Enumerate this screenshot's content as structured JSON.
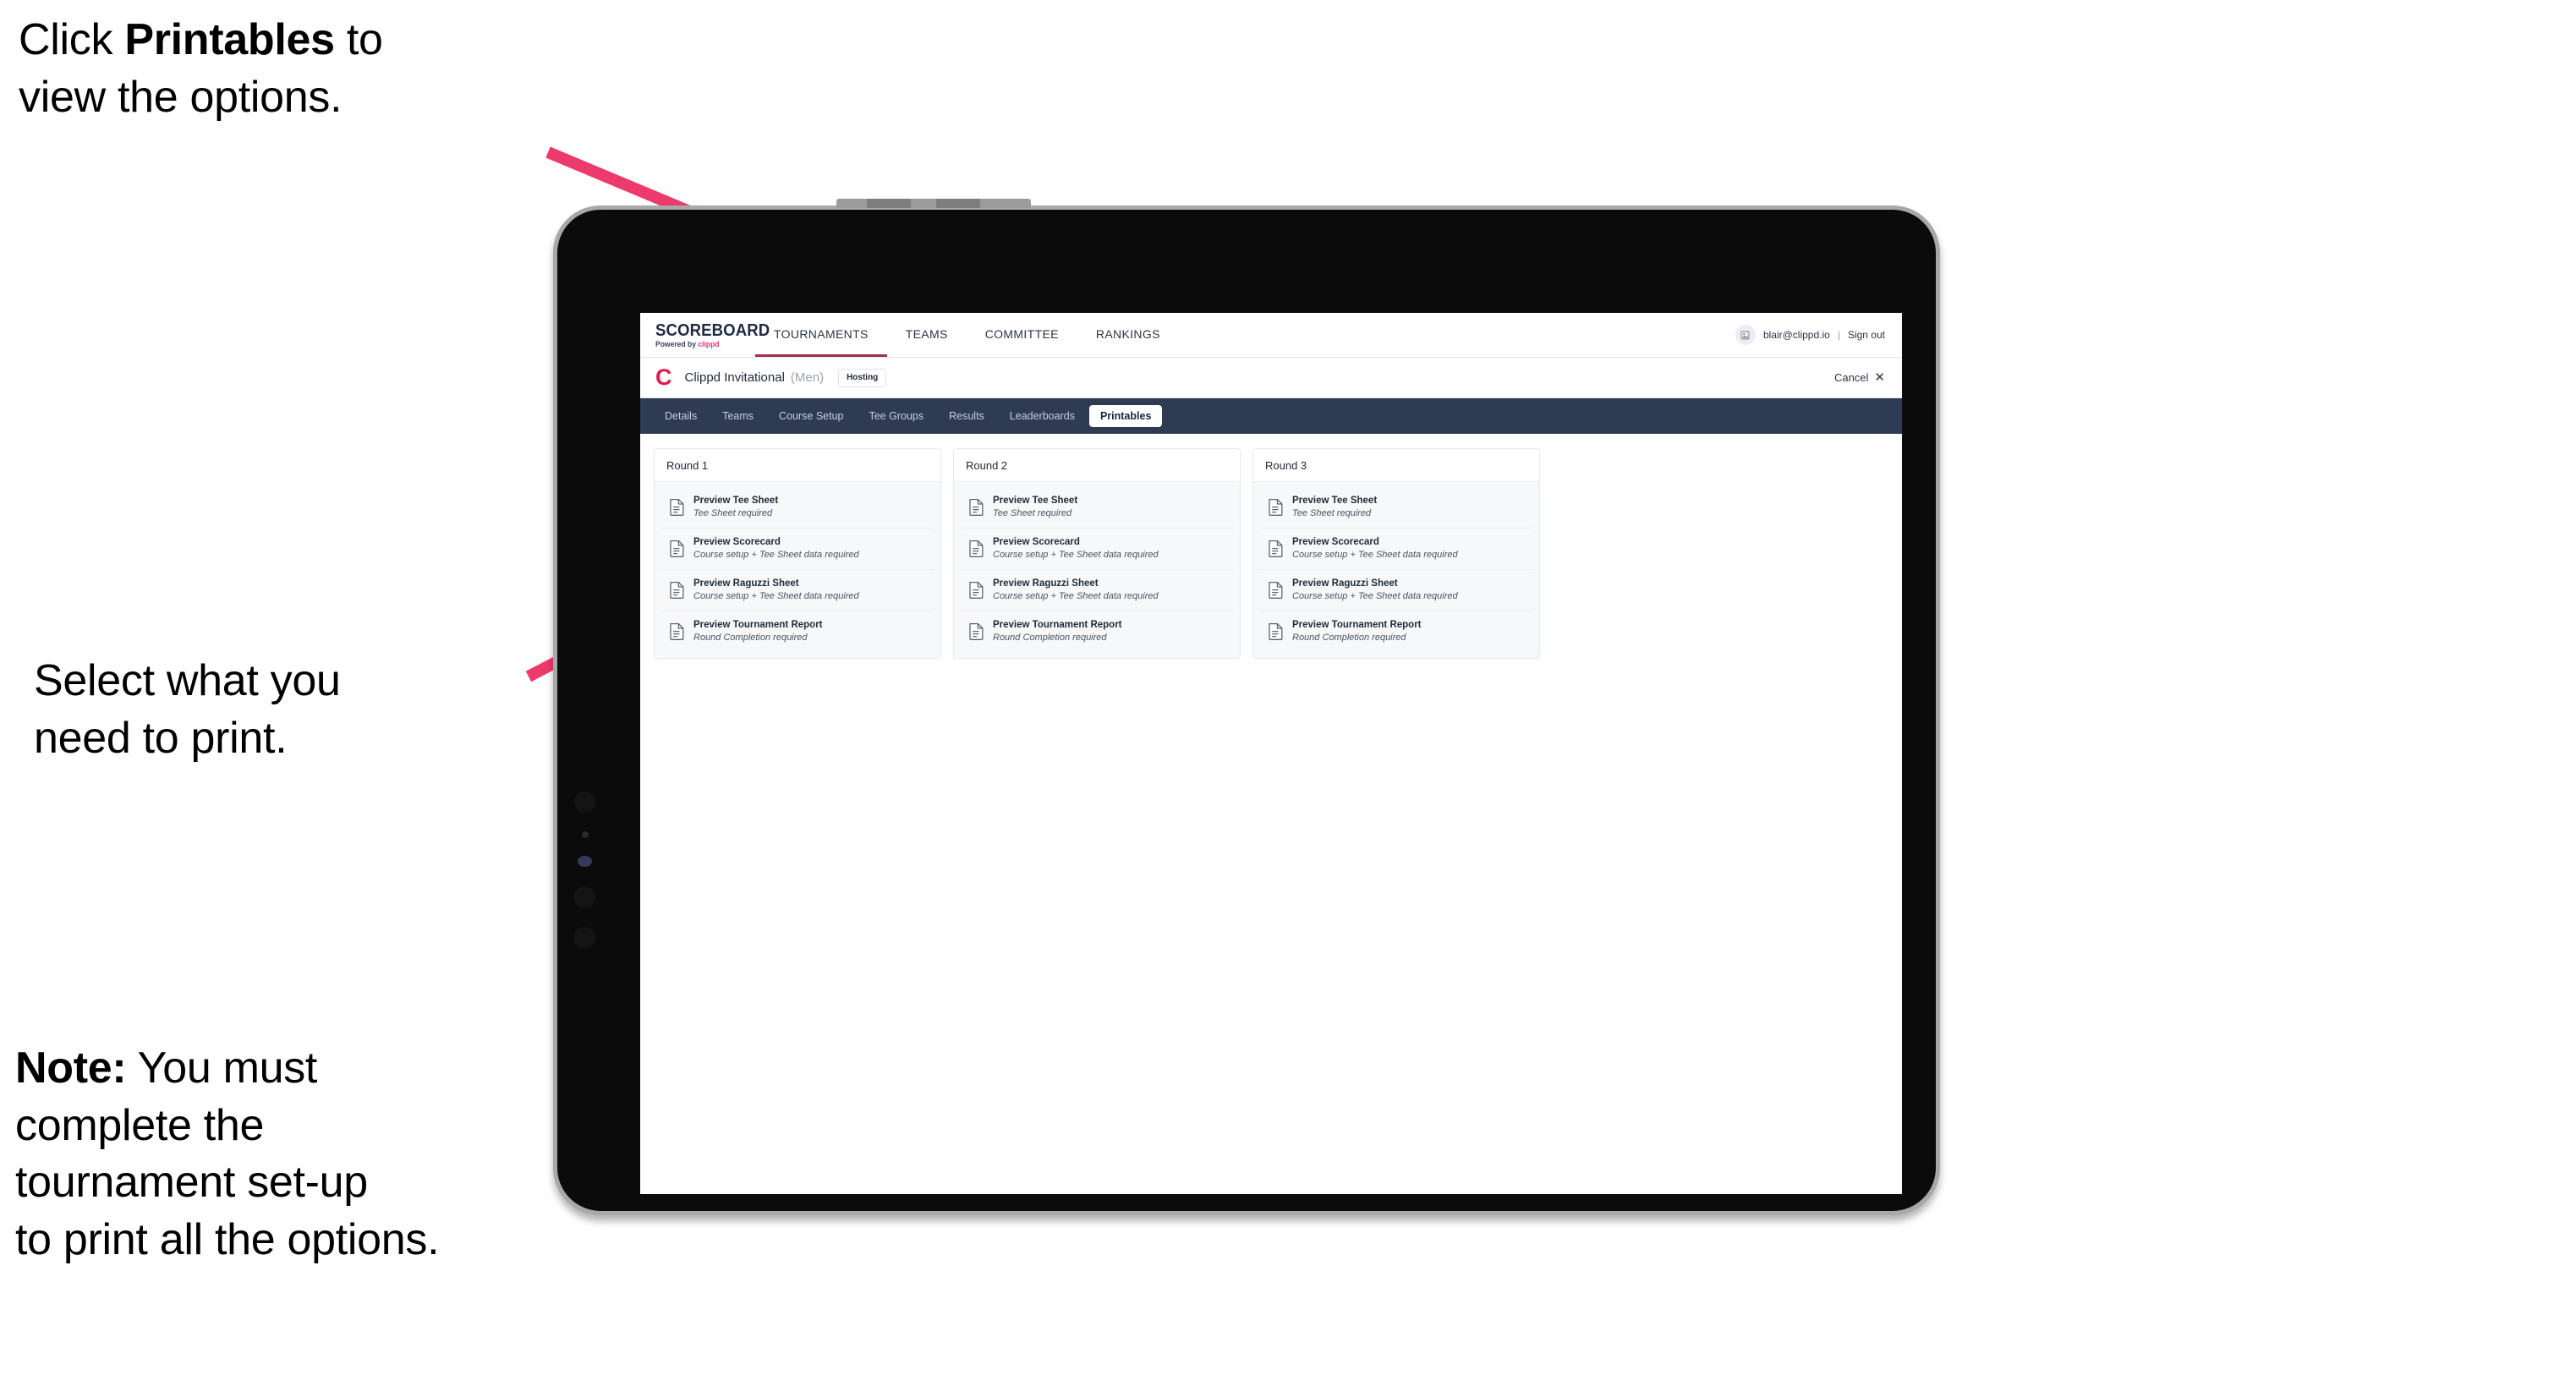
{
  "annotations": {
    "top": {
      "before": "Click ",
      "bold": "Printables",
      "after": " to\nview the options."
    },
    "middle": {
      "text": "Select what you\n need to print."
    },
    "note": {
      "bold": "Note:",
      "text": " You must\ncomplete the\ntournament set-up\nto print all the options."
    }
  },
  "colors": {
    "accent_pink": "#ec3a6d",
    "brand_red": "#e0194e",
    "nav_dark": "#2e3b52",
    "active_underline": "#a62b48",
    "bezel": "#a8a8a8",
    "screen_bg": "#ffffff"
  },
  "app": {
    "logo": {
      "word": "SCOREBOARD",
      "powered_prefix": "Powered by ",
      "brand": "clippd"
    },
    "top_nav": [
      {
        "label": "TOURNAMENTS",
        "active": true
      },
      {
        "label": "TEAMS",
        "active": false
      },
      {
        "label": "COMMITTEE",
        "active": false
      },
      {
        "label": "RANKINGS",
        "active": false
      }
    ],
    "account": {
      "avatar_icon": "user-avatar-icon",
      "email": "blair@clippd.io",
      "separator": "|",
      "sign_out": "Sign out"
    },
    "tournament_bar": {
      "logo_mark": "C",
      "name": "Clippd Invitational",
      "gender": "(Men)",
      "status_badge": "Hosting",
      "cancel_label": "Cancel",
      "cancel_icon": "close-icon"
    },
    "sub_tabs": [
      {
        "label": "Details",
        "active": false
      },
      {
        "label": "Teams",
        "active": false
      },
      {
        "label": "Course Setup",
        "active": false
      },
      {
        "label": "Tee Groups",
        "active": false
      },
      {
        "label": "Results",
        "active": false
      },
      {
        "label": "Leaderboards",
        "active": false
      },
      {
        "label": "Printables",
        "active": true
      }
    ],
    "rounds": [
      {
        "title": "Round 1",
        "items": [
          {
            "title": "Preview Tee Sheet",
            "subtitle": "Tee Sheet required"
          },
          {
            "title": "Preview Scorecard",
            "subtitle": "Course setup + Tee Sheet data required"
          },
          {
            "title": "Preview Raguzzi Sheet",
            "subtitle": "Course setup + Tee Sheet data required"
          },
          {
            "title": "Preview Tournament Report",
            "subtitle": "Round Completion required"
          }
        ]
      },
      {
        "title": "Round 2",
        "items": [
          {
            "title": "Preview Tee Sheet",
            "subtitle": "Tee Sheet required"
          },
          {
            "title": "Preview Scorecard",
            "subtitle": "Course setup + Tee Sheet data required"
          },
          {
            "title": "Preview Raguzzi Sheet",
            "subtitle": "Course setup + Tee Sheet data required"
          },
          {
            "title": "Preview Tournament Report",
            "subtitle": "Round Completion required"
          }
        ]
      },
      {
        "title": "Round 3",
        "items": [
          {
            "title": "Preview Tee Sheet",
            "subtitle": "Tee Sheet required"
          },
          {
            "title": "Preview Scorecard",
            "subtitle": "Course setup + Tee Sheet data required"
          },
          {
            "title": "Preview Raguzzi Sheet",
            "subtitle": "Course setup + Tee Sheet data required"
          },
          {
            "title": "Preview Tournament Report",
            "subtitle": "Round Completion required"
          }
        ]
      }
    ]
  }
}
